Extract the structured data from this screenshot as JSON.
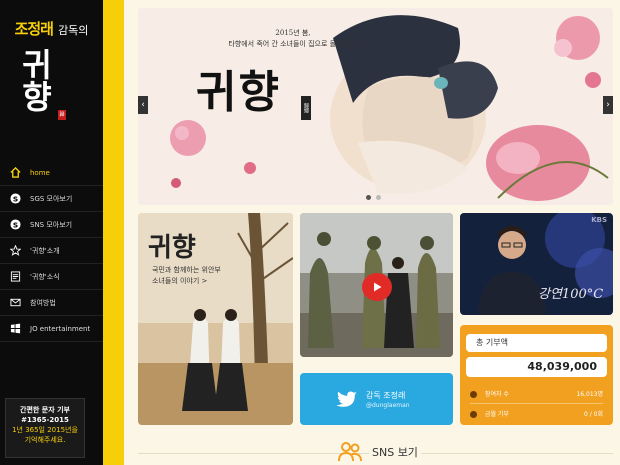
{
  "brand": {
    "director_name": "조정래",
    "director_suffix": "감독의",
    "title": "귀향",
    "seal": "歸"
  },
  "nav": [
    {
      "label": "home",
      "icon": "home-icon",
      "active": true
    },
    {
      "label": "SGS 모아보기",
      "icon": "s-circle-icon"
    },
    {
      "label": "SNS 모아보기",
      "icon": "s-circle-icon"
    },
    {
      "label": "'귀향'소개",
      "icon": "star-icon"
    },
    {
      "label": "'귀향'소식",
      "icon": "news-icon"
    },
    {
      "label": "참여방법",
      "icon": "mail-icon"
    },
    {
      "label": "JO entertainment",
      "icon": "windows-icon"
    }
  ],
  "donate_box": {
    "title": "간편한 문자 기부",
    "number": "#1365-2015",
    "line1": "1년 365일 2015년을",
    "line2": "기억해주세요."
  },
  "banner": {
    "subtitle1": "2015년 봄,",
    "subtitle2": "타향에서 죽어 간 소녀들이 집으로 돌아온다.",
    "title": "귀향",
    "seal": "歸鄕"
  },
  "poster": {
    "title": "귀향",
    "tagline1": "국민과 함께하는 위안부",
    "tagline2": "소녀들의 이야기 >"
  },
  "video": {
    "badge": "KBS",
    "logo": "강연100°C"
  },
  "twitter": {
    "name": "감독 조정래",
    "handle": "@dunglaeman"
  },
  "donation": {
    "label": "총 기부액",
    "amount": "48,039,000",
    "participants_label": "참여자 수",
    "participants_value": "16,013명",
    "monthly_label": "금월 기부",
    "monthly_value": "0 / 0회"
  },
  "sns_title": "SNS 보기",
  "colors": {
    "accent": "#f6cf09",
    "sidebar": "#0c0c0c",
    "twitter": "#2aa9e0",
    "donation": "#f1a020"
  }
}
